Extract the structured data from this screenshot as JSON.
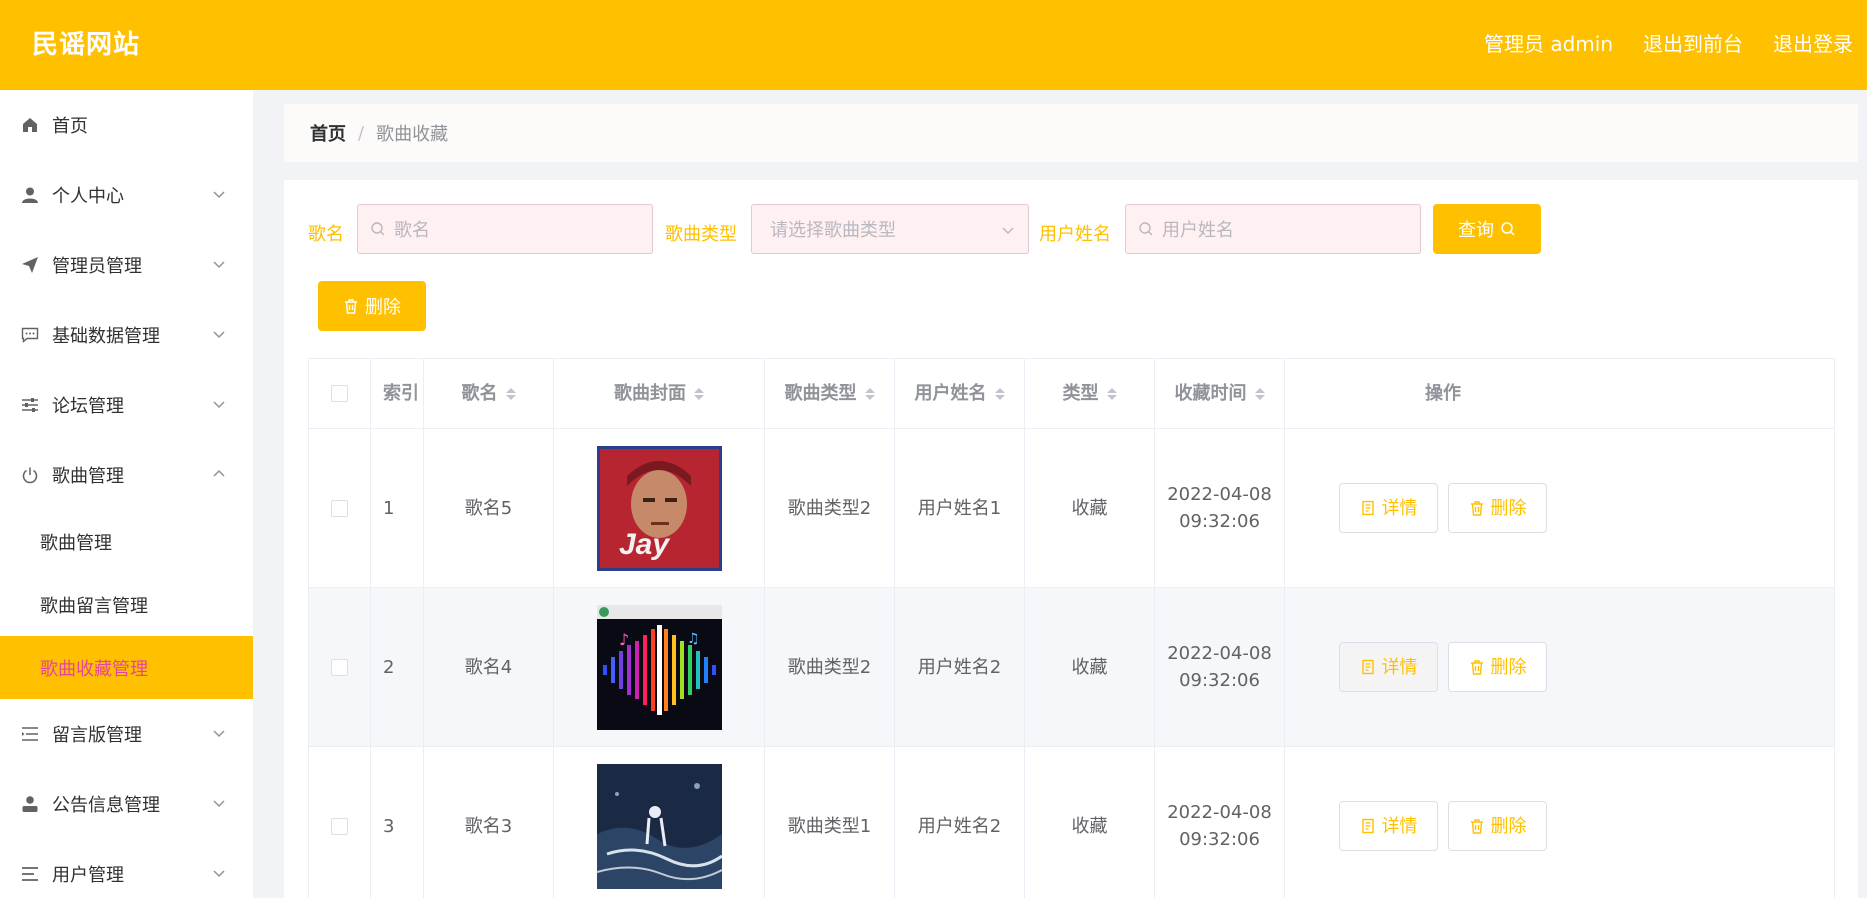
{
  "header": {
    "brand": "民谣网站",
    "links": [
      "管理员 admin",
      "退出到前台",
      "退出登录"
    ]
  },
  "sidebar": {
    "items": [
      {
        "label": "首页",
        "icon": "home-icon"
      },
      {
        "label": "个人中心",
        "icon": "user-icon"
      },
      {
        "label": "管理员管理",
        "icon": "send-icon"
      },
      {
        "label": "基础数据管理",
        "icon": "chat-icon"
      },
      {
        "label": "论坛管理",
        "icon": "sliders-icon"
      },
      {
        "label": "歌曲管理",
        "icon": "power-icon"
      }
    ],
    "sub_items": [
      "歌曲管理",
      "歌曲留言管理",
      "歌曲收藏管理"
    ],
    "items_after": [
      {
        "label": "留言版管理",
        "icon": "list-icon"
      },
      {
        "label": "公告信息管理",
        "icon": "person-icon"
      },
      {
        "label": "用户管理",
        "icon": "menu-icon"
      }
    ]
  },
  "breadcrumb": {
    "home": "首页",
    "separator": "/",
    "current": "歌曲收藏"
  },
  "filters": {
    "song_label": "歌名",
    "song_placeholder": "歌名",
    "type_label": "歌曲类型",
    "type_placeholder": "请选择歌曲类型",
    "user_label": "用户姓名",
    "user_placeholder": "用户姓名",
    "query_button": "查询",
    "delete_button": "删除"
  },
  "table": {
    "headers": {
      "index": "索引",
      "name": "歌名",
      "cover": "歌曲封面",
      "type": "歌曲类型",
      "user": "用户姓名",
      "kind": "类型",
      "time": "收藏时间",
      "ops": "操作"
    },
    "rows": [
      {
        "index": "1",
        "name": "歌名5",
        "type": "歌曲类型2",
        "user": "用户姓名1",
        "kind": "收藏",
        "time": "2022-04-08 09:32:06"
      },
      {
        "index": "2",
        "name": "歌名4",
        "type": "歌曲类型2",
        "user": "用户姓名2",
        "kind": "收藏",
        "time": "2022-04-08 09:32:06"
      },
      {
        "index": "3",
        "name": "歌名3",
        "type": "歌曲类型1",
        "user": "用户姓名2",
        "kind": "收藏",
        "time": "2022-04-08 09:32:06"
      }
    ],
    "detail_label": "详情",
    "remove_label": "删除"
  },
  "colors": {
    "accent": "#ffc000",
    "active_text": "#e6469a"
  }
}
